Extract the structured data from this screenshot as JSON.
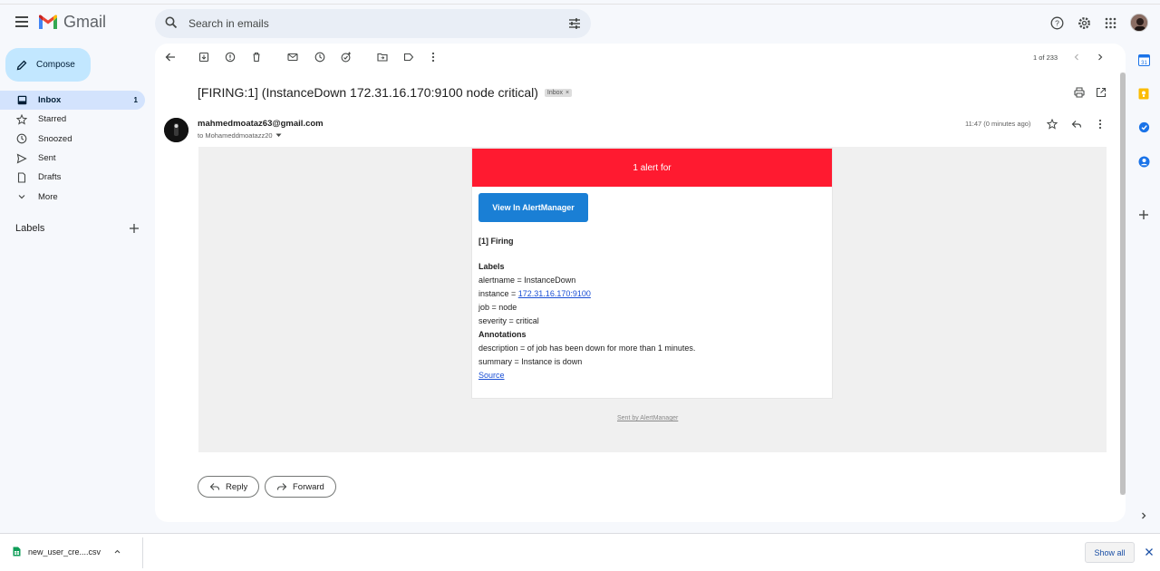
{
  "app": {
    "name": "Gmail"
  },
  "search": {
    "placeholder": "Search in emails"
  },
  "sidebar": {
    "compose_label": "Compose",
    "items": [
      {
        "label": "Inbox",
        "count": "1",
        "icon": "inbox-icon"
      },
      {
        "label": "Starred",
        "count": "",
        "icon": "star-icon"
      },
      {
        "label": "Snoozed",
        "count": "",
        "icon": "clock-icon"
      },
      {
        "label": "Sent",
        "count": "",
        "icon": "send-icon"
      },
      {
        "label": "Drafts",
        "count": "",
        "icon": "draft-icon"
      },
      {
        "label": "More",
        "count": "",
        "icon": "chevron-down-icon"
      }
    ],
    "labels_heading": "Labels"
  },
  "toolbar": {
    "pagination": "1 of 233"
  },
  "email": {
    "subject": "[FIRING:1] (InstanceDown 172.31.16.170:9100 node critical)",
    "folder_badge": "Inbox",
    "sender": "mahmedmoataz63@gmail.com",
    "recipient": "to Mohameddmoatazz20",
    "time": "11:47 (0 minutes ago)",
    "body": {
      "header": "1 alert for",
      "button": "View In AlertManager",
      "firing": "[1] Firing",
      "labels_heading": "Labels",
      "alertname": "alertname = InstanceDown",
      "instance_prefix": "instance = ",
      "instance_link": "172.31.16.170:9100",
      "job": "job = node",
      "severity": "severity = critical",
      "annotations_heading": "Annotations",
      "description": "description = of job has been down for more than 1 minutes.",
      "summary": "summary = Instance is down",
      "source_link": "Source",
      "footer": "Sent by AlertManager"
    },
    "reply_label": "Reply",
    "forward_label": "Forward"
  },
  "downloads": {
    "file_name": "new_user_cre....csv",
    "show_all": "Show all"
  },
  "colors": {
    "alert_header": "#ff1a30",
    "alertmanager_button": "#1a7fd5",
    "compose_bg": "#c2e7ff",
    "inbox_active": "#d3e3fd"
  }
}
